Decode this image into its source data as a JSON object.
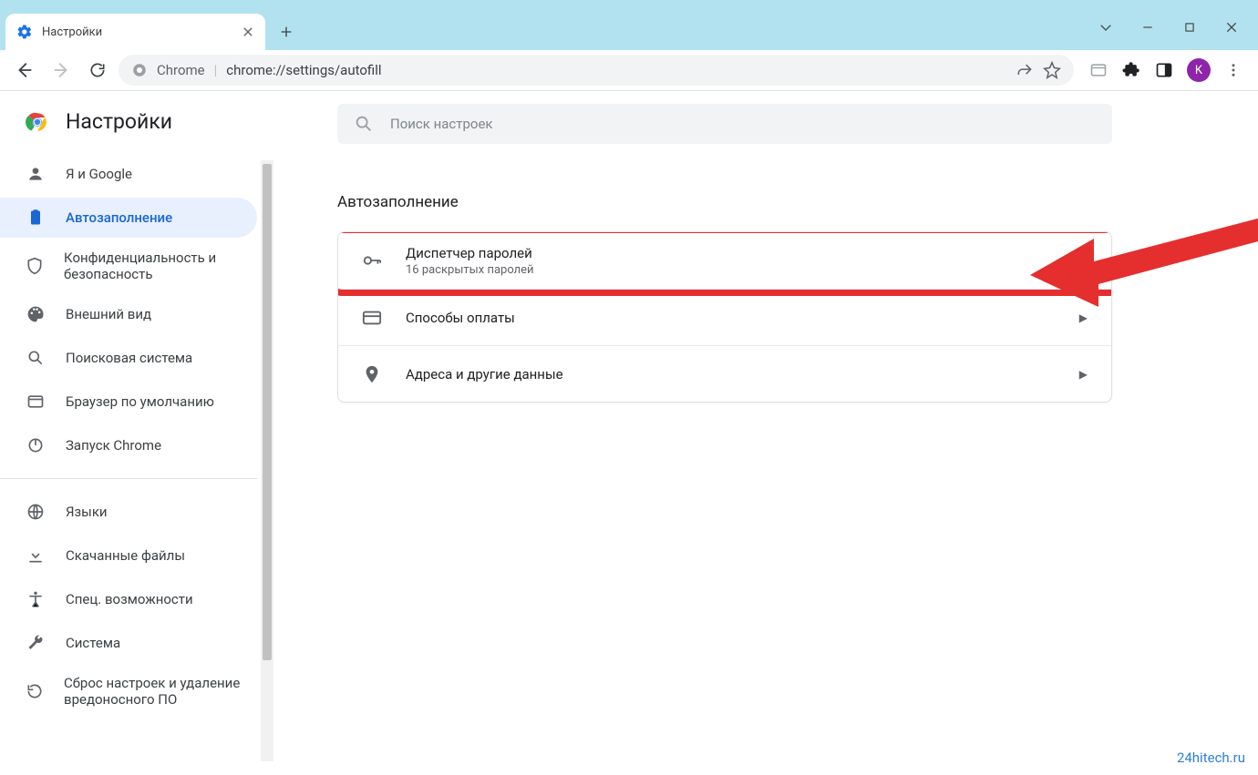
{
  "tab": {
    "title": "Настройки"
  },
  "omnibox": {
    "prefix": "Chrome",
    "url": "chrome://settings/autofill"
  },
  "avatar_letter": "K",
  "brand": "Настройки",
  "search_placeholder": "Поиск настроек",
  "section_title": "Автозаполнение",
  "sidebar": {
    "items": [
      {
        "label": "Я и Google"
      },
      {
        "label": "Автозаполнение"
      },
      {
        "label": "Конфиденциальность и безопасность"
      },
      {
        "label": "Внешний вид"
      },
      {
        "label": "Поисковая система"
      },
      {
        "label": "Браузер по умолчанию"
      },
      {
        "label": "Запуск Chrome"
      }
    ],
    "items2": [
      {
        "label": "Языки"
      },
      {
        "label": "Скачанные файлы"
      },
      {
        "label": "Спец. возможности"
      },
      {
        "label": "Система"
      },
      {
        "label": "Сброс настроек и удаление вредоносного ПО"
      }
    ]
  },
  "rows": [
    {
      "title": "Диспетчер паролей",
      "subtitle": "16 раскрытых паролей"
    },
    {
      "title": "Способы оплаты"
    },
    {
      "title": "Адреса и другие данные"
    }
  ],
  "watermark": "24hitech.ru"
}
